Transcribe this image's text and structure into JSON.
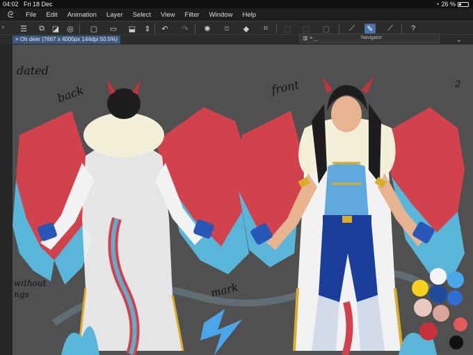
{
  "status_bar": {
    "time": "04:02",
    "date": "Fri 18 Dec",
    "battery": "26 %",
    "battery_level": 0.26
  },
  "menu": {
    "items": [
      "File",
      "Edit",
      "Animation",
      "Layer",
      "Select",
      "View",
      "Filter",
      "Window",
      "Help"
    ]
  },
  "document_tab": {
    "label": "Oh deer (7667 x 4000px 144dpi 50.5%)"
  },
  "navigator": {
    "title": "Navigator"
  },
  "canvas_text": {
    "top_left": "dated",
    "back": "back",
    "front": "front",
    "mark": "mark",
    "without": "without",
    "ngs": "ngs",
    "number": "2"
  },
  "palette_colors": [
    "#f5f5f5",
    "#4aa6e8",
    "#f5d21f",
    "#1e4b9e",
    "#2f6fd1",
    "#e8c9bf",
    "#d9a59a",
    "#e05a5a",
    "#c8303a",
    "#101010"
  ],
  "colors": {
    "wing_red": "#d1424d",
    "wing_blue": "#5ab6d9",
    "coat_white": "#f2f2f2",
    "gold": "#d9ac2a",
    "vest_blue": "#5fa9df",
    "pants_navy": "#1c3e9b",
    "glove_blue": "#2957b8",
    "fur_cream": "#f4efd9"
  }
}
